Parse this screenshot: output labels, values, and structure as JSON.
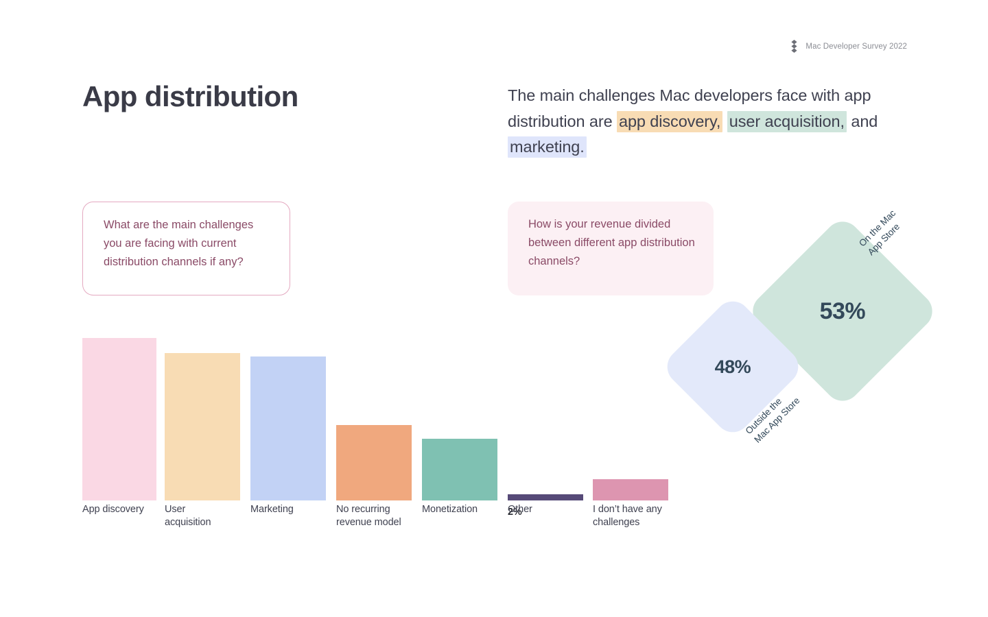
{
  "brand": {
    "logo_icon": "stacked-diamonds-logo",
    "text": "Mac Developer Survey 2022"
  },
  "page_title": "App distribution",
  "summary": {
    "part1": "The main challenges Mac developers face with app distribution are ",
    "highlight1": "app discovery,",
    "part2": " ",
    "highlight2": "user acquisition,",
    "part3": " and ",
    "highlight3": "marketing.",
    "highlight1_color": "#f8dcb4",
    "highlight2_color": "#cfe5dc",
    "highlight3_color": "#dfe5fb"
  },
  "callouts": {
    "left": "What are the main challenges you are facing with current distribution channels if any?",
    "right": "How is your revenue divided between different app distribution channels?"
  },
  "chart_data": {
    "type": "bar",
    "title": "What are the main challenges you are facing with current distribution channels if any?",
    "xlabel": "",
    "ylabel": "",
    "ylim": [
      0,
      60
    ],
    "grid": false,
    "legend": "none",
    "unit": "%",
    "categories": [
      "App discovery",
      "User acquisition",
      "Marketing",
      "No recurring revenue model",
      "Monetization",
      "Other",
      "I don’t have any challenges"
    ],
    "values": [
      57,
      52,
      51,
      27,
      22,
      2,
      7
    ],
    "value_labels": [
      "57%",
      "52%",
      "51%",
      "27%",
      "22%",
      "2%",
      "7%"
    ],
    "colors": [
      "#fad8e4",
      "#f8dcb4",
      "#c2d2f5",
      "#f0a87e",
      "#7fc1b2",
      "#564a78",
      "#dd95b0"
    ]
  },
  "revenue_split": {
    "type": "pie",
    "title": "How is your revenue divided between different app distribution channels?",
    "categories": [
      "On the Mac App Store",
      "Outside the Mac App Store"
    ],
    "values": [
      53,
      48
    ],
    "items": [
      {
        "label": "On the Mac\nApp Store",
        "value": "53%",
        "color": "#cfe5dc"
      },
      {
        "label": "Outside the\nMac App Store",
        "value": "48%",
        "color": "#e3e9fa"
      }
    ]
  }
}
